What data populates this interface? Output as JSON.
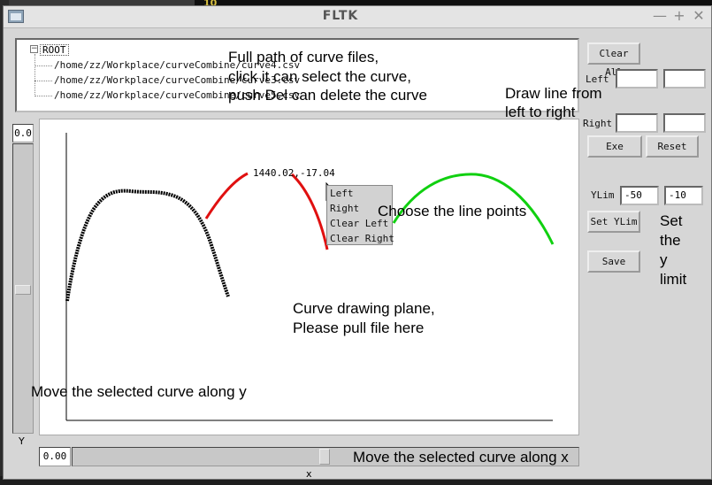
{
  "background": {
    "counter": "10"
  },
  "window": {
    "title": "FLTK",
    "minimize": "—",
    "maximize": "+",
    "close": "✕"
  },
  "tree": {
    "root": "ROOT",
    "collapse_symbol": "−",
    "items": [
      "/home/zz/Workplace/curveCombine/curve4.csv",
      "/home/zz/Workplace/curveCombine/curve3.csv",
      "/home/zz/Workplace/curveCombine/curve5.csv"
    ]
  },
  "plot": {
    "coordinate_readout": "1440.02,-17.04",
    "context_menu": [
      "Left",
      "Right",
      "Clear Left",
      "Clear Right"
    ],
    "curve_colors": [
      "#000000",
      "#e01010",
      "#10e010"
    ]
  },
  "sliders": {
    "y_value": "0.0",
    "y_label": "Y",
    "x_value": "0.00",
    "x_label": "x"
  },
  "panel": {
    "clear_all": "Clear All",
    "left_label": "Left",
    "left_from": "",
    "left_to": "",
    "right_label": "Right",
    "right_from": "",
    "right_to": "",
    "exe": "Exe",
    "reset": "Reset",
    "ylim_label": "YLim",
    "ylim_min": "-50",
    "ylim_max": "-10",
    "set_ylim": "Set YLim",
    "save": "Save"
  },
  "annotations": {
    "tree_note_1": "Full path of curve files,",
    "tree_note_2": "click it can select the curve,",
    "tree_note_3": "push Del can delete the curve",
    "draw_note_1": "Draw line from",
    "draw_note_2": "left to right",
    "choose_note": "Choose the line points",
    "ylim_note": [
      "Set",
      "the",
      "y",
      "limit"
    ],
    "plane_note_1": "Curve drawing plane,",
    "plane_note_2": "Please pull file here",
    "move_y": "Move the selected curve along y",
    "move_x": "Move the selected curve along x"
  }
}
